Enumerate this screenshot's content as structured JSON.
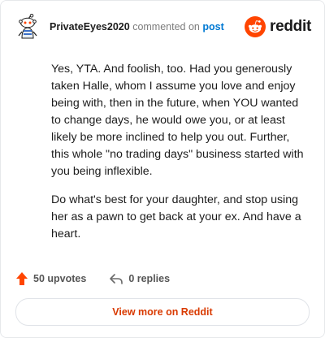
{
  "header": {
    "username": "PrivateEyes2020",
    "action": "commented on",
    "post_link": "post",
    "brand": "reddit"
  },
  "comment": {
    "paragraphs": [
      "Yes, YTA. And foolish, too. Had you generously taken Halle, whom I assume you love and enjoy being with, then in the future, when YOU wanted to change days, he would owe you, or at least likely be more inclined to help you out. Further, this whole \"no trading days\" business started with you being inflexible.",
      "Do what's best for your daughter, and stop using her as a pawn to get back at your ex. And have a heart."
    ]
  },
  "footer": {
    "upvotes": "50 upvotes",
    "replies": "0 replies"
  },
  "view_more": "View more on Reddit",
  "colors": {
    "brand_orange": "#ff4500",
    "link_blue": "#0079d3",
    "button_text": "#d93a00"
  },
  "icons": {
    "avatar": "snoo-avatar-icon",
    "brand": "reddit-snoo-icon",
    "upvote": "upvote-arrow-icon",
    "reply": "reply-arrow-icon"
  }
}
